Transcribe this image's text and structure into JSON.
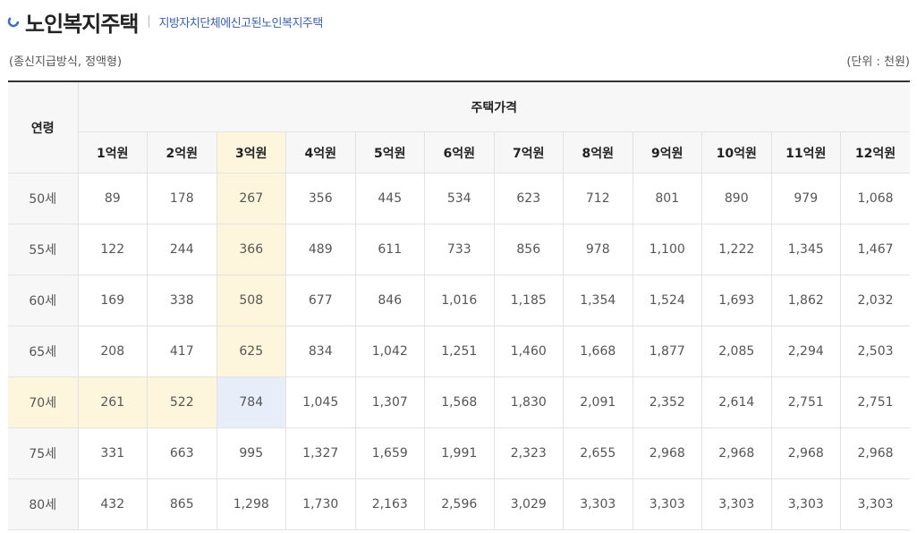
{
  "header": {
    "title": "노인복지주택",
    "subtitle": "지방자치단체에신고된노인복지주택"
  },
  "notes": {
    "left": "(종신지급방식, 정액형)",
    "right": "(단위 : 천원)"
  },
  "table": {
    "age_header": "연령",
    "group_header": "주택가격",
    "columns": [
      "1억원",
      "2억원",
      "3억원",
      "4억원",
      "5억원",
      "6억원",
      "7억원",
      "8억원",
      "9억원",
      "10억원",
      "11억원",
      "12억원"
    ],
    "rows": [
      {
        "age": "50세",
        "values": [
          "89",
          "178",
          "267",
          "356",
          "445",
          "534",
          "623",
          "712",
          "801",
          "890",
          "979",
          "1,068"
        ]
      },
      {
        "age": "55세",
        "values": [
          "122",
          "244",
          "366",
          "489",
          "611",
          "733",
          "856",
          "978",
          "1,100",
          "1,222",
          "1,345",
          "1,467"
        ]
      },
      {
        "age": "60세",
        "values": [
          "169",
          "338",
          "508",
          "677",
          "846",
          "1,016",
          "1,185",
          "1,354",
          "1,524",
          "1,693",
          "1,862",
          "2,032"
        ]
      },
      {
        "age": "65세",
        "values": [
          "208",
          "417",
          "625",
          "834",
          "1,042",
          "1,251",
          "1,460",
          "1,668",
          "1,877",
          "2,085",
          "2,294",
          "2,503"
        ]
      },
      {
        "age": "70세",
        "values": [
          "261",
          "522",
          "784",
          "1,045",
          "1,307",
          "1,568",
          "1,830",
          "2,091",
          "2,352",
          "2,614",
          "2,751",
          "2,751"
        ]
      },
      {
        "age": "75세",
        "values": [
          "331",
          "663",
          "995",
          "1,327",
          "1,659",
          "1,991",
          "2,323",
          "2,655",
          "2,968",
          "2,968",
          "2,968",
          "2,968"
        ]
      },
      {
        "age": "80세",
        "values": [
          "432",
          "865",
          "1,298",
          "1,730",
          "2,163",
          "2,596",
          "3,029",
          "3,303",
          "3,303",
          "3,303",
          "3,303",
          "3,303"
        ]
      }
    ],
    "highlight_colors": {
      "row_col": "#fdf6dd",
      "intersection": "#e8eef9"
    }
  }
}
